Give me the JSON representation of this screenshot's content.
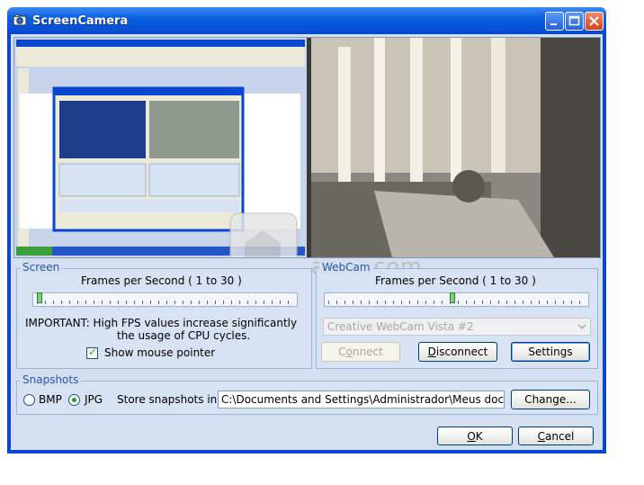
{
  "window": {
    "title": "ScreenCamera"
  },
  "screen": {
    "legend": "Screen",
    "fps_label": "Frames per Second ( 1 to 30 )",
    "fps_value": 1,
    "important": "IMPORTANT: High FPS values increase significantly",
    "important2": "the usage of CPU cycles.",
    "show_mouse_label": "Show mouse pointer",
    "show_mouse_checked": true
  },
  "webcam": {
    "legend": "WebCam",
    "fps_label": "Frames per Second ( 1 to 30 )",
    "fps_value": 15,
    "device": "Creative WebCam Vista #2",
    "connect": {
      "pre": "C",
      "key": "o",
      "post": "nnect"
    },
    "disconnect": {
      "key": "D",
      "post": "isconnect"
    },
    "settings": "Settings"
  },
  "snapshots": {
    "legend": "Snapshots",
    "format_bmp": "BMP",
    "format_jpg": "JPG",
    "selected_format": "JPG",
    "store_label": "Store snapshots in:",
    "path": "C:\\Documents and Settings\\Administrador\\Meus docur",
    "change": "Change..."
  },
  "footer": {
    "ok": {
      "key": "O",
      "post": "K"
    },
    "cancel": {
      "key": "C",
      "post": "ancel"
    }
  },
  "watermark": "anxz.com",
  "colors": {
    "title_bar": "#0a5fe0",
    "legend_text": "#2a56b0",
    "client": "#d4dff0"
  }
}
